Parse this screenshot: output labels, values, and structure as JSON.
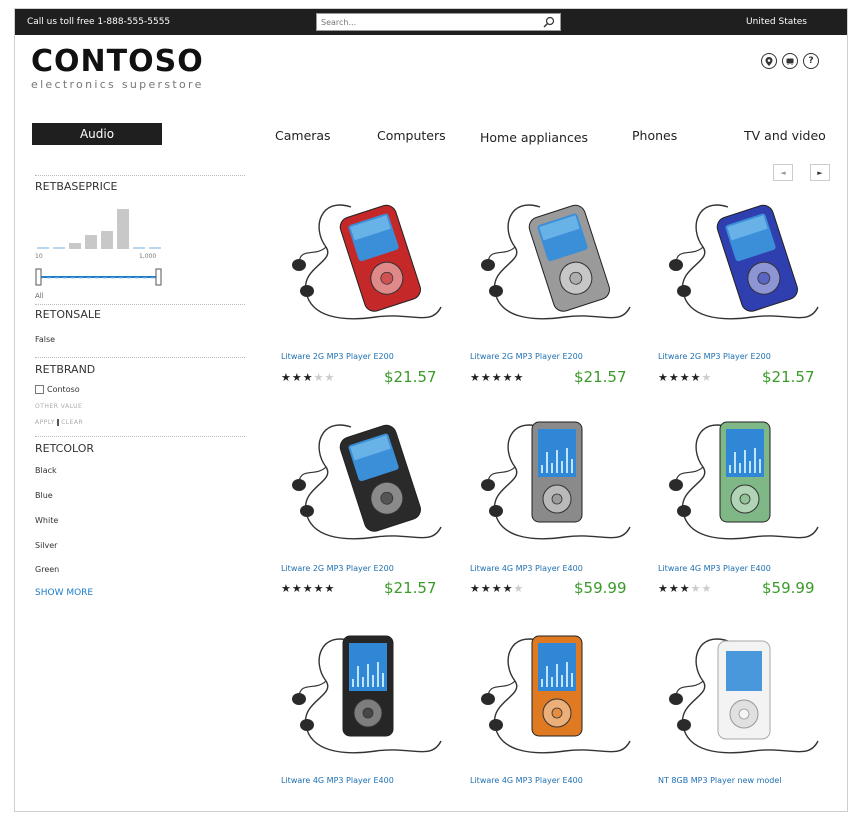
{
  "topbar": {
    "phone_text": "Call us toll free 1-888-555-5555",
    "search_placeholder": "Search...",
    "country": "United States"
  },
  "brand": {
    "name": "CONTOSO",
    "tagline": "electronics superstore"
  },
  "header_icons": [
    "location-icon",
    "cart-icon",
    "help-icon"
  ],
  "nav": {
    "active": "Audio",
    "items": [
      "Cameras",
      "Computers",
      "Home appliances",
      "Phones",
      "TV and video"
    ]
  },
  "filters": {
    "price": {
      "heading": "RETBASEPRICE",
      "range_min": "10",
      "range_max": "1,000",
      "all_label": "All",
      "histogram": [
        0.05,
        0.05,
        0.15,
        0.35,
        0.45,
        1.0,
        0.05,
        0.05
      ]
    },
    "onsale": {
      "heading": "RETONSALE",
      "value": "False"
    },
    "brand": {
      "heading": "RETBRAND",
      "option": "Contoso",
      "other_value": "OTHER VALUE",
      "apply": "APPLY",
      "clear": "CLEAR"
    },
    "color": {
      "heading": "RETCOLOR",
      "options": [
        "Black",
        "Blue",
        "White",
        "Silver",
        "Green"
      ],
      "show_more": "SHOW MORE"
    }
  },
  "carousel": {
    "prev": "◄",
    "next": "►"
  },
  "products": [
    {
      "name": "Litware 2G MP3 Player E200",
      "rating": 3,
      "price": "$21.57",
      "color": "#c42828"
    },
    {
      "name": "Litware 2G MP3 Player E200",
      "rating": 5,
      "price": "$21.57",
      "color": "#9a9a9a"
    },
    {
      "name": "Litware 2G MP3 Player E200",
      "rating": 4,
      "price": "$21.57",
      "color": "#2f3fb0"
    },
    {
      "name": "Litware 2G MP3 Player E200",
      "rating": 5,
      "price": "$21.57",
      "color": "#2a2a2a"
    },
    {
      "name": "Litware 4G MP3 Player E400",
      "rating": 4,
      "price": "$59.99",
      "color": "#8a8a8a"
    },
    {
      "name": "Litware 4G MP3 Player E400",
      "rating": 3,
      "price": "$59.99",
      "color": "#7fb886"
    },
    {
      "name": "Litware 4G MP3 Player E400",
      "rating": null,
      "price": "",
      "color": "#262626"
    },
    {
      "name": "Litware 4G MP3 Player E400",
      "rating": null,
      "price": "",
      "color": "#e07a22"
    },
    {
      "name": "NT 8GB MP3 Player new model",
      "rating": null,
      "price": "",
      "color": "#e8e8e8"
    }
  ]
}
